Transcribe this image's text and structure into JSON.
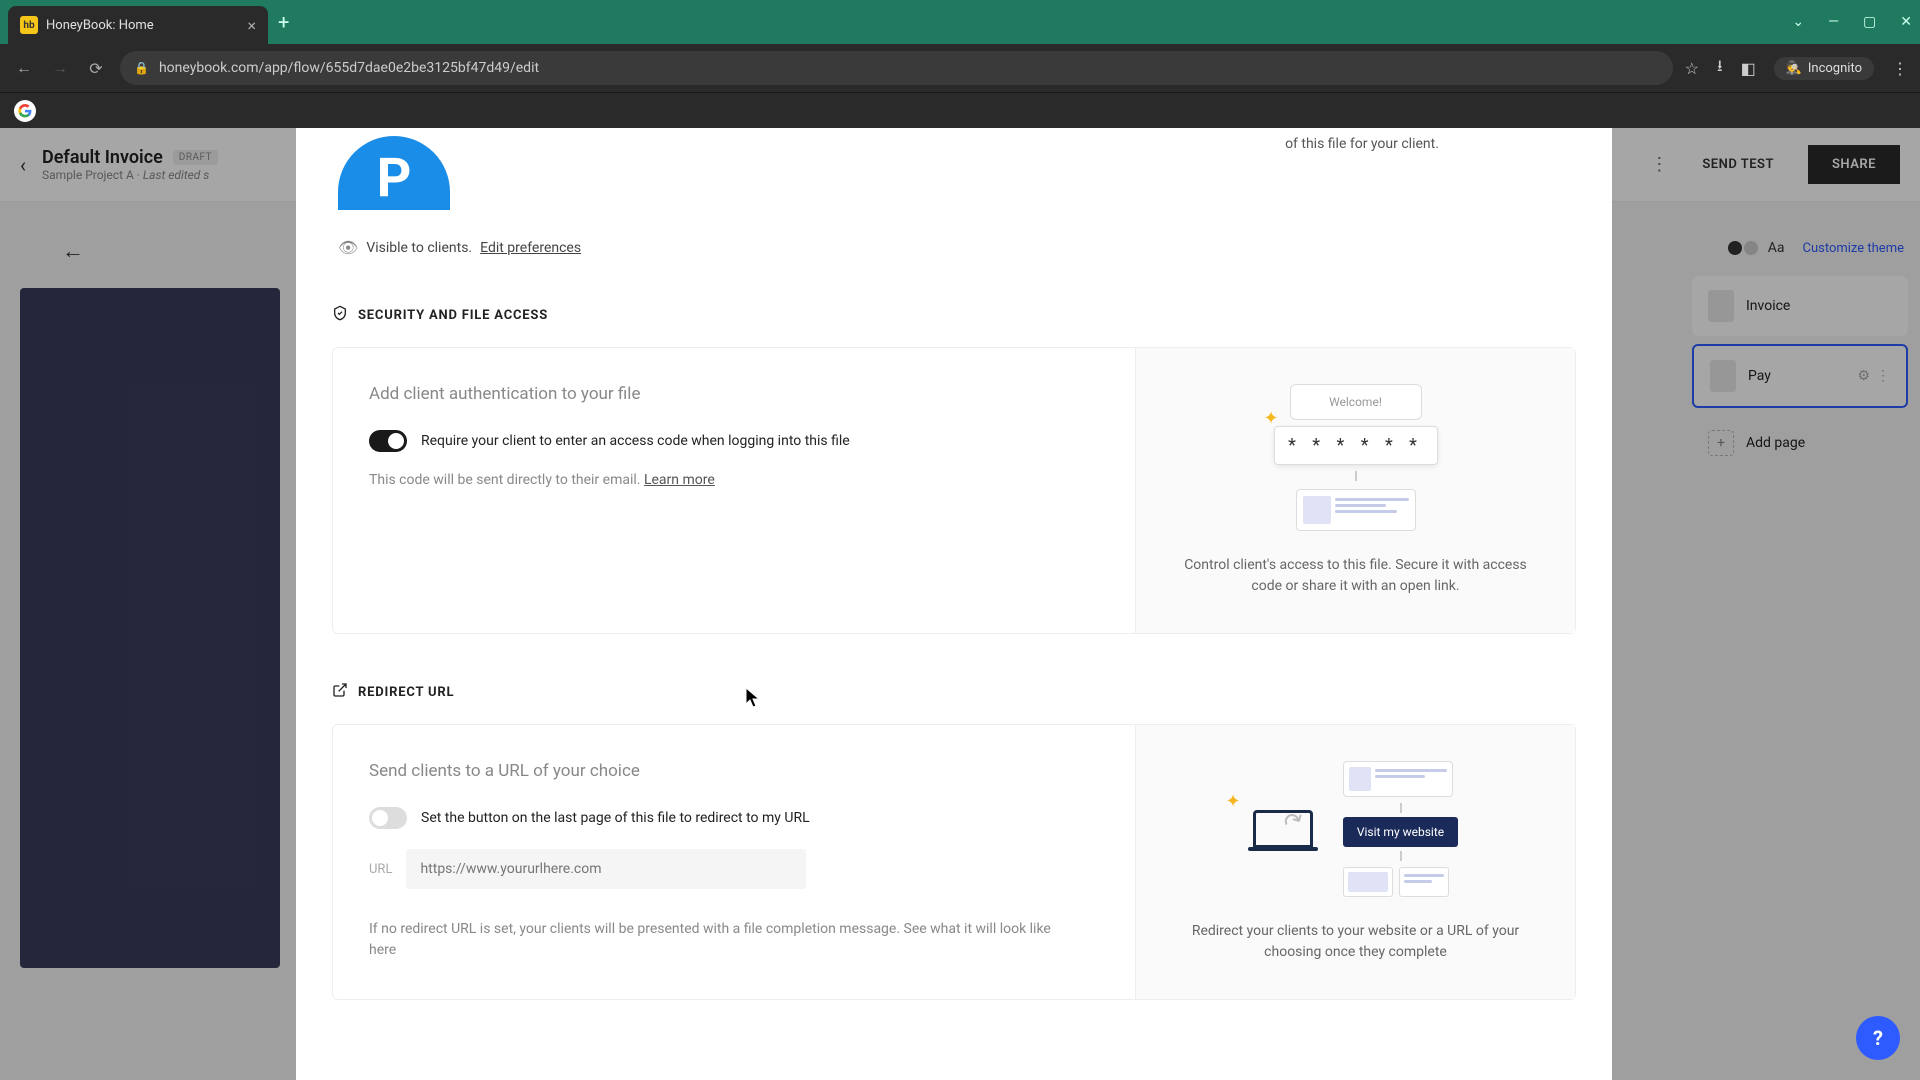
{
  "browser": {
    "tab_title": "HoneyBook: Home",
    "url": "honeybook.com/app/flow/655d7dae0e2be3125bf47d49/edit",
    "incognito_label": "Incognito"
  },
  "header": {
    "back_aria": "Back",
    "title": "Default Invoice",
    "badge": "DRAFT",
    "project": "Sample Project A",
    "last_edited": "Last edited s",
    "send_test": "SEND TEST",
    "share": "SHARE"
  },
  "sidebar": {
    "aa": "Aa",
    "customize": "Customize theme",
    "pages": [
      {
        "label": "Invoice"
      },
      {
        "label": "Pay"
      }
    ],
    "add_page": "Add page"
  },
  "modal": {
    "top_hint": "of this file for your client.",
    "logo": {
      "visible_text": "Visible to clients.",
      "edit_prefs": "Edit preferences"
    },
    "security": {
      "heading": "SECURITY AND FILE ACCESS",
      "subtitle": "Add client authentication to your file",
      "toggle_label": "Require your client to enter an access code when logging into this file",
      "help": "This code will be sent directly to their email.",
      "learn_more": "Learn more",
      "illus_welcome": "Welcome!",
      "illus_code": "* * * * * *",
      "caption": "Control client's access to this file. Secure it with access code or share it with an open link."
    },
    "redirect": {
      "heading": "REDIRECT URL",
      "subtitle": "Send clients to a URL of your choice",
      "toggle_label": "Set the button on the last page of this file to redirect to my URL",
      "url_label": "URL",
      "url_placeholder": "https://www.yoururlhere.com",
      "footer": "If no redirect URL is set, your clients will be presented with a file completion message. See what it will look like here",
      "illus_btn": "Visit my website",
      "caption": "Redirect your clients to your website or a URL of your choosing once they complete"
    }
  }
}
